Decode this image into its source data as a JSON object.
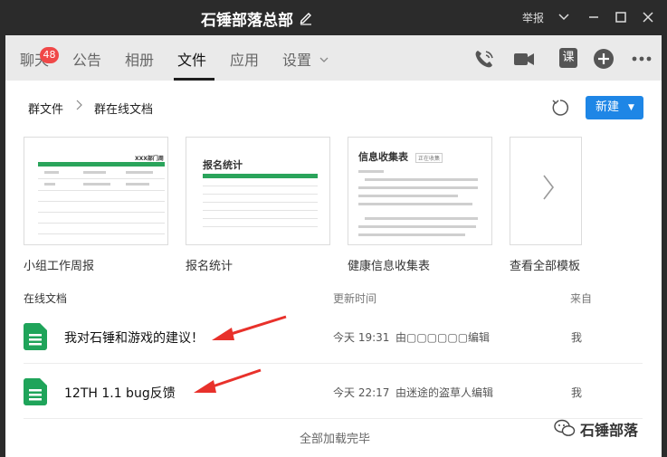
{
  "window": {
    "title": "石锤部落总部",
    "report_label": "举报"
  },
  "nav": {
    "tabs": [
      {
        "label": "聊天"
      },
      {
        "label": "公告"
      },
      {
        "label": "相册"
      },
      {
        "label": "文件"
      },
      {
        "label": "应用"
      },
      {
        "label": "设置"
      }
    ],
    "chat_badge": "48",
    "active_tab": "文件",
    "course_label": "课"
  },
  "breadcrumb": {
    "root": "群文件",
    "current": "群在线文档"
  },
  "toolbar": {
    "new_label": "新建"
  },
  "templates": [
    {
      "label": "小组工作周报",
      "preview_title": "XXX部门周"
    },
    {
      "label": "报名统计",
      "preview_title": "报名统计"
    },
    {
      "label": "健康信息收集表",
      "preview_title": "信息收集表",
      "preview_tag": "正在收集"
    },
    {
      "label": "查看全部模板"
    }
  ],
  "list_header": {
    "name": "在线文档",
    "time": "更新时间",
    "from": "来自"
  },
  "documents": [
    {
      "name": "我对石锤和游戏的建议！",
      "time": "今天 19:31",
      "editor": "由▢▢▢▢▢▢编辑",
      "from": "我"
    },
    {
      "name": "12TH 1.1 bug反馈",
      "time": "今天 22:17",
      "editor": "由迷途的盗草人编辑",
      "from": "我"
    }
  ],
  "footer": {
    "status": "全部加载完毕"
  },
  "watermark": {
    "text": "石锤部落"
  },
  "colors": {
    "titlebar": "#2b2b2b",
    "accent_blue": "#1e86e6",
    "sheet_green": "#1fa45a",
    "badge_red": "#f04848",
    "annotation_red": "#e8312b"
  }
}
